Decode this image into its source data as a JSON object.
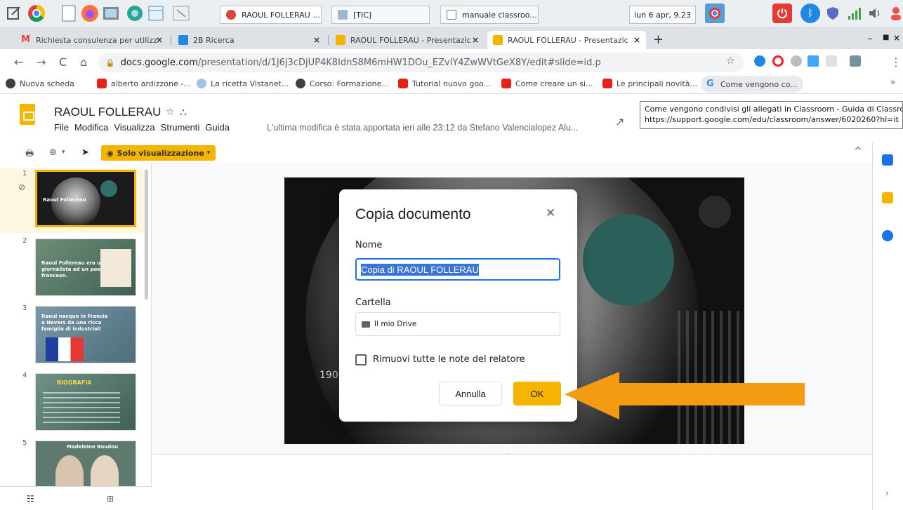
{
  "taskbar": {
    "tasks": [
      {
        "label": "RAOUL FOLLERAU ...",
        "color": "#ea4335"
      },
      {
        "label": "[TIC]",
        "color": "#9fb7cf"
      },
      {
        "label": "manuale classroo...",
        "color": "#cfd8dc"
      }
    ],
    "clock": "lun 6 apr, 9.23"
  },
  "browser": {
    "tabs": [
      {
        "label": "Richiesta consulenza per utilizz",
        "icon": "gmail-icon",
        "color": "#ea4335"
      },
      {
        "label": "2B Ricerca",
        "icon": "classroom-icon",
        "color": "#1e88e5"
      },
      {
        "label": "RAOUL FOLLERAU - Presentazic",
        "icon": "slides-icon",
        "color": "#f4b400"
      },
      {
        "label": "RAOUL FOLLERAU - Presentazic",
        "icon": "slides-icon",
        "color": "#f4b400"
      }
    ],
    "url_host": "docs.google.com",
    "url_path": "/presentation/d/1J6j3cDjUP4K8IdnS8M6mHW1DOu_EZvlY4ZwWVtGeX8Y/edit#slide=id.p",
    "bookmarks": [
      {
        "label": "Nuova scheda",
        "color": "#3c4043"
      },
      {
        "label": "alberto ardizzone -...",
        "color": "#e62117"
      },
      {
        "label": "La ricetta Vistanet...",
        "color": "#9fc4e8"
      },
      {
        "label": "Corso: Formazione...",
        "color": "#3c4043"
      },
      {
        "label": "Tutorial nuovo goo...",
        "color": "#e62117"
      },
      {
        "label": "Come creare un si...",
        "color": "#e62117"
      },
      {
        "label": "Le principali novità...",
        "color": "#e62117"
      },
      {
        "label": "Come vengono co...",
        "color": "#4285f4"
      }
    ]
  },
  "doc": {
    "title": "RAOUL FOLLERAU",
    "menu": [
      "File",
      "Modifica",
      "Visualizza",
      "Strumenti",
      "Guida"
    ],
    "last_edit": "L'ultima modifica è stata apportata ieri alle 23:12 da Stefano Valencialopez Alu...",
    "view_only": "Solo visualizzazione"
  },
  "tooltip": {
    "line1": "Come vengono condivisi gli allegati in Classroom - Guida di Classroom",
    "line2": "https://support.google.com/edu/classroom/answer/6020260?hl=it"
  },
  "filmstrip": {
    "slides": [
      {
        "num": "1",
        "text": "Raoul Follereau"
      },
      {
        "num": "2",
        "text": "Raoul Follereau era un giornalista ed un poeta francese."
      },
      {
        "num": "3",
        "text": "Raoul nacque in Francia a Nevers da una ricca famiglia di industriali"
      },
      {
        "num": "4",
        "text": "BIOGRAFIA"
      },
      {
        "num": "5",
        "text": "Madeleine Boudou"
      }
    ]
  },
  "slide": {
    "partial_text": "190"
  },
  "dialog": {
    "title": "Copia documento",
    "name_label": "Nome",
    "name_value": "Copia di RAOUL FOLLERAU",
    "folder_label": "Cartella",
    "folder_value": "Il mio Drive",
    "notes_label": "Rimuovi tutte le note del relatore",
    "cancel": "Annulla",
    "ok": "OK"
  },
  "colors": {
    "accent": "#f4b400",
    "arrow": "#f39c12",
    "focus": "#1a73e8"
  }
}
